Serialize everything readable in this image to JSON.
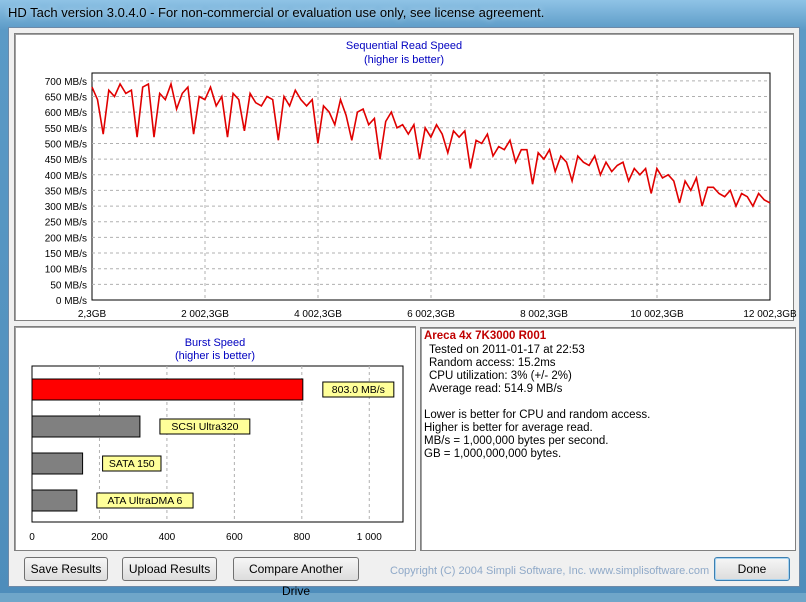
{
  "window": {
    "title": "HD Tach version 3.0.4.0  - For non-commercial or evaluation use only, see license agreement."
  },
  "read_chart": {
    "title": "Sequential Read Speed",
    "subtitle": "(higher is better)",
    "line_color": "#e00000"
  },
  "burst_chart": {
    "title": "Burst Speed",
    "subtitle": "(higher is better)"
  },
  "chart_data": [
    {
      "type": "line",
      "title": "Sequential Read Speed",
      "subtitle": "(higher is better)",
      "xlabel": "",
      "ylabel": "",
      "x_unit": "GB",
      "x_ticks": [
        "2,3GB",
        "2 002,3GB",
        "4 002,3GB",
        "6 002,3GB",
        "8 002,3GB",
        "10 002,3GB",
        "12 002,3GB"
      ],
      "y_ticks": [
        "0 MB/s",
        "50 MB/s",
        "100 MB/s",
        "150 MB/s",
        "200 MB/s",
        "250 MB/s",
        "300 MB/s",
        "350 MB/s",
        "400 MB/s",
        "450 MB/s",
        "500 MB/s",
        "550 MB/s",
        "600 MB/s",
        "650 MB/s",
        "700 MB/s"
      ],
      "xlim": [
        2.3,
        12002.3
      ],
      "ylim": [
        0,
        725
      ],
      "grid": true,
      "series": [
        {
          "x": [
            2.3,
            100,
            200,
            300,
            400,
            500,
            600,
            700,
            800,
            900,
            1000,
            1100,
            1200,
            1300,
            1400,
            1500,
            1600,
            1700,
            1800,
            1900,
            2000,
            2100,
            2200,
            2300,
            2400,
            2500,
            2600,
            2700,
            2800,
            2900,
            3000,
            3100,
            3200,
            3300,
            3400,
            3500,
            3600,
            3700,
            3800,
            3900,
            4000,
            4100,
            4200,
            4300,
            4400,
            4500,
            4600,
            4700,
            4800,
            4900,
            5000,
            5100,
            5200,
            5300,
            5400,
            5500,
            5600,
            5700,
            5800,
            5900,
            6000,
            6100,
            6200,
            6300,
            6400,
            6500,
            6600,
            6700,
            6800,
            6900,
            7000,
            7100,
            7200,
            7300,
            7400,
            7500,
            7600,
            7700,
            7800,
            7900,
            8000,
            8100,
            8200,
            8300,
            8400,
            8500,
            8600,
            8700,
            8800,
            8900,
            9000,
            9100,
            9200,
            9300,
            9400,
            9500,
            9600,
            9700,
            9800,
            9900,
            10000,
            10100,
            10200,
            10300,
            10400,
            10500,
            10600,
            10700,
            10800,
            10900,
            11000,
            11100,
            11200,
            11300,
            11400,
            11500,
            11600,
            11700,
            11800,
            11900,
            12002.3
          ],
          "y": [
            680,
            640,
            530,
            670,
            650,
            690,
            660,
            670,
            520,
            680,
            690,
            520,
            660,
            640,
            690,
            610,
            660,
            680,
            530,
            650,
            640,
            680,
            620,
            650,
            520,
            660,
            640,
            540,
            660,
            630,
            620,
            650,
            640,
            510,
            650,
            620,
            670,
            640,
            620,
            640,
            500,
            620,
            600,
            560,
            640,
            590,
            510,
            600,
            610,
            560,
            580,
            450,
            570,
            600,
            550,
            560,
            530,
            560,
            450,
            550,
            520,
            560,
            530,
            470,
            540,
            520,
            540,
            420,
            510,
            500,
            530,
            460,
            490,
            480,
            510,
            440,
            480,
            480,
            370,
            470,
            450,
            480,
            410,
            460,
            440,
            380,
            460,
            440,
            430,
            460,
            400,
            440,
            410,
            430,
            440,
            380,
            420,
            400,
            420,
            340,
            420,
            390,
            400,
            380,
            310,
            380,
            350,
            390,
            300,
            360,
            360,
            340,
            330,
            350,
            300,
            340,
            330,
            300,
            340,
            320,
            310
          ]
        }
      ]
    },
    {
      "type": "bar",
      "orientation": "horizontal",
      "title": "Burst Speed",
      "subtitle": "(higher is better)",
      "categories": [
        "803.0 MB/s",
        "SCSI Ultra320",
        "SATA 150",
        "ATA UltraDMA 6"
      ],
      "values": [
        803.0,
        320,
        150,
        133
      ],
      "colors": [
        "#ff0000",
        "#808080",
        "#808080",
        "#808080"
      ],
      "x_ticks": [
        "0",
        "200",
        "400",
        "600",
        "800",
        "1 000"
      ],
      "xlim": [
        0,
        1100
      ],
      "grid": true
    }
  ],
  "info": {
    "title": "Areca 4x 7K3000 R001",
    "tested_on": "Tested on 2011-01-17 at 22:53",
    "random_access": "Random access: 15.2ms",
    "cpu_utilization": "CPU utilization: 3% (+/- 2%)",
    "average_read": "Average read: 514.9 MB/s",
    "note1": "Lower is better for CPU and random access.",
    "note2": "Higher is better for average read.",
    "note3": "MB/s = 1,000,000 bytes per second.",
    "note4": "GB = 1,000,000,000 bytes."
  },
  "buttons": {
    "save": "Save Results",
    "upload": "Upload Results",
    "compare": "Compare Another Drive",
    "done": "Done"
  },
  "footer": {
    "copyright": "Copyright (C) 2004 Simpli Software, Inc. www.simplisoftware.com"
  }
}
